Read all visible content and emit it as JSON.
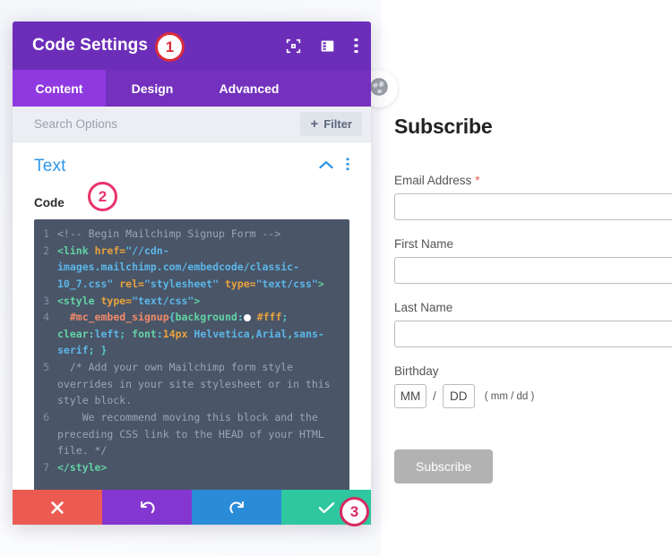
{
  "modal": {
    "title": "Code Settings",
    "header_icons": [
      {
        "name": "fullscreen-icon",
        "label": "Expand"
      },
      {
        "name": "layout-split-icon",
        "label": "Change Layout"
      },
      {
        "name": "more-vertical-icon",
        "label": "More Options"
      }
    ],
    "tabs": [
      {
        "label": "Content",
        "active": true
      },
      {
        "label": "Design",
        "active": false
      },
      {
        "label": "Advanced",
        "active": false
      }
    ],
    "search": {
      "placeholder": "Search Options",
      "value": ""
    },
    "filter": {
      "plus": "+",
      "label": "Filter"
    },
    "section": {
      "title": "Text",
      "collapse_icon": "chevron-up-icon",
      "menu_icon": "more-vertical-icon"
    },
    "field": {
      "label": "Code"
    },
    "actions": [
      {
        "name": "cancel-button",
        "icon": "✕",
        "color": "#ec5b52"
      },
      {
        "name": "undo-button",
        "icon": "↺",
        "color": "#8437d0"
      },
      {
        "name": "redo-button",
        "icon": "↻",
        "color": "#2a8bd6"
      },
      {
        "name": "save-button",
        "icon": "✓",
        "color": "#2ec7a0"
      }
    ]
  },
  "code": {
    "lines": [
      {
        "num": "1",
        "text": "<!-- Begin Mailchimp Signup Form -->"
      },
      {
        "num": "2",
        "text": "<link href=\"//cdn-images.mailchimp.com/embedcode/classic-10_7.css\" rel=\"stylesheet\" type=\"text/css\">"
      },
      {
        "num": "3",
        "text": "<style type=\"text/css\">"
      },
      {
        "num": "4",
        "text": "  #mc_embed_signup{background: #fff; clear:left; font:14px Helvetica,Arial,sans-serif; }"
      },
      {
        "num": "5",
        "text": "  /* Add your own Mailchimp form style overrides in your site stylesheet or in this style block."
      },
      {
        "num": "6",
        "text": "     We recommend moving this block and the preceding CSS link to the HEAD of your HTML file. */"
      },
      {
        "num": "7",
        "text": "</style>"
      }
    ]
  },
  "form": {
    "title": "Subscribe",
    "fields": [
      {
        "label": "Email Address",
        "required": true,
        "required_mark": "*",
        "value": "",
        "name": "email-field"
      },
      {
        "label": "First Name",
        "required": false,
        "required_mark": "",
        "value": "",
        "name": "first-name-field"
      },
      {
        "label": "Last Name",
        "required": false,
        "required_mark": "",
        "value": "",
        "name": "last-name-field"
      }
    ],
    "birthday": {
      "label": "Birthday",
      "month_value": "MM",
      "separator": "/",
      "day_value": "DD",
      "hint": "( mm / dd )"
    },
    "submit_label": "Subscribe"
  },
  "globe_button": {
    "icon": "globe-icon"
  },
  "badges": [
    {
      "text": "1",
      "color": "#d92b3e"
    },
    {
      "text": "2",
      "color": "#e8336b"
    },
    {
      "text": "3",
      "color": "#d62a60"
    }
  ]
}
